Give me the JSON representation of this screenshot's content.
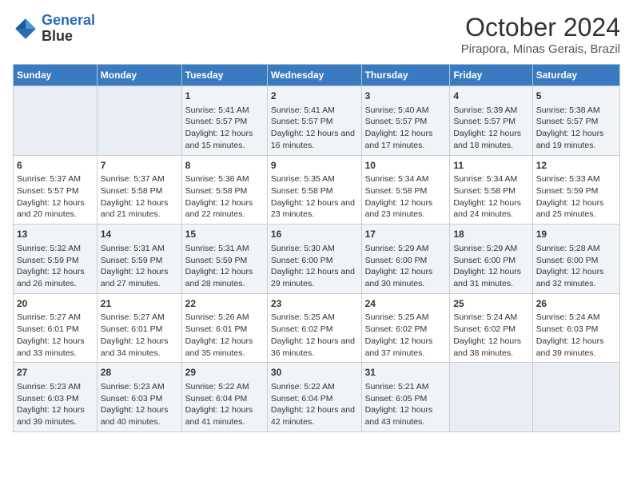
{
  "logo": {
    "line1": "General",
    "line2": "Blue"
  },
  "title": "October 2024",
  "location": "Pirapora, Minas Gerais, Brazil",
  "days_of_week": [
    "Sunday",
    "Monday",
    "Tuesday",
    "Wednesday",
    "Thursday",
    "Friday",
    "Saturday"
  ],
  "weeks": [
    [
      {
        "day": "",
        "sunrise": "",
        "sunset": "",
        "daylight": ""
      },
      {
        "day": "",
        "sunrise": "",
        "sunset": "",
        "daylight": ""
      },
      {
        "day": "1",
        "sunrise": "Sunrise: 5:41 AM",
        "sunset": "Sunset: 5:57 PM",
        "daylight": "Daylight: 12 hours and 15 minutes."
      },
      {
        "day": "2",
        "sunrise": "Sunrise: 5:41 AM",
        "sunset": "Sunset: 5:57 PM",
        "daylight": "Daylight: 12 hours and 16 minutes."
      },
      {
        "day": "3",
        "sunrise": "Sunrise: 5:40 AM",
        "sunset": "Sunset: 5:57 PM",
        "daylight": "Daylight: 12 hours and 17 minutes."
      },
      {
        "day": "4",
        "sunrise": "Sunrise: 5:39 AM",
        "sunset": "Sunset: 5:57 PM",
        "daylight": "Daylight: 12 hours and 18 minutes."
      },
      {
        "day": "5",
        "sunrise": "Sunrise: 5:38 AM",
        "sunset": "Sunset: 5:57 PM",
        "daylight": "Daylight: 12 hours and 19 minutes."
      }
    ],
    [
      {
        "day": "6",
        "sunrise": "Sunrise: 5:37 AM",
        "sunset": "Sunset: 5:57 PM",
        "daylight": "Daylight: 12 hours and 20 minutes."
      },
      {
        "day": "7",
        "sunrise": "Sunrise: 5:37 AM",
        "sunset": "Sunset: 5:58 PM",
        "daylight": "Daylight: 12 hours and 21 minutes."
      },
      {
        "day": "8",
        "sunrise": "Sunrise: 5:36 AM",
        "sunset": "Sunset: 5:58 PM",
        "daylight": "Daylight: 12 hours and 22 minutes."
      },
      {
        "day": "9",
        "sunrise": "Sunrise: 5:35 AM",
        "sunset": "Sunset: 5:58 PM",
        "daylight": "Daylight: 12 hours and 23 minutes."
      },
      {
        "day": "10",
        "sunrise": "Sunrise: 5:34 AM",
        "sunset": "Sunset: 5:58 PM",
        "daylight": "Daylight: 12 hours and 23 minutes."
      },
      {
        "day": "11",
        "sunrise": "Sunrise: 5:34 AM",
        "sunset": "Sunset: 5:58 PM",
        "daylight": "Daylight: 12 hours and 24 minutes."
      },
      {
        "day": "12",
        "sunrise": "Sunrise: 5:33 AM",
        "sunset": "Sunset: 5:59 PM",
        "daylight": "Daylight: 12 hours and 25 minutes."
      }
    ],
    [
      {
        "day": "13",
        "sunrise": "Sunrise: 5:32 AM",
        "sunset": "Sunset: 5:59 PM",
        "daylight": "Daylight: 12 hours and 26 minutes."
      },
      {
        "day": "14",
        "sunrise": "Sunrise: 5:31 AM",
        "sunset": "Sunset: 5:59 PM",
        "daylight": "Daylight: 12 hours and 27 minutes."
      },
      {
        "day": "15",
        "sunrise": "Sunrise: 5:31 AM",
        "sunset": "Sunset: 5:59 PM",
        "daylight": "Daylight: 12 hours and 28 minutes."
      },
      {
        "day": "16",
        "sunrise": "Sunrise: 5:30 AM",
        "sunset": "Sunset: 6:00 PM",
        "daylight": "Daylight: 12 hours and 29 minutes."
      },
      {
        "day": "17",
        "sunrise": "Sunrise: 5:29 AM",
        "sunset": "Sunset: 6:00 PM",
        "daylight": "Daylight: 12 hours and 30 minutes."
      },
      {
        "day": "18",
        "sunrise": "Sunrise: 5:29 AM",
        "sunset": "Sunset: 6:00 PM",
        "daylight": "Daylight: 12 hours and 31 minutes."
      },
      {
        "day": "19",
        "sunrise": "Sunrise: 5:28 AM",
        "sunset": "Sunset: 6:00 PM",
        "daylight": "Daylight: 12 hours and 32 minutes."
      }
    ],
    [
      {
        "day": "20",
        "sunrise": "Sunrise: 5:27 AM",
        "sunset": "Sunset: 6:01 PM",
        "daylight": "Daylight: 12 hours and 33 minutes."
      },
      {
        "day": "21",
        "sunrise": "Sunrise: 5:27 AM",
        "sunset": "Sunset: 6:01 PM",
        "daylight": "Daylight: 12 hours and 34 minutes."
      },
      {
        "day": "22",
        "sunrise": "Sunrise: 5:26 AM",
        "sunset": "Sunset: 6:01 PM",
        "daylight": "Daylight: 12 hours and 35 minutes."
      },
      {
        "day": "23",
        "sunrise": "Sunrise: 5:25 AM",
        "sunset": "Sunset: 6:02 PM",
        "daylight": "Daylight: 12 hours and 36 minutes."
      },
      {
        "day": "24",
        "sunrise": "Sunrise: 5:25 AM",
        "sunset": "Sunset: 6:02 PM",
        "daylight": "Daylight: 12 hours and 37 minutes."
      },
      {
        "day": "25",
        "sunrise": "Sunrise: 5:24 AM",
        "sunset": "Sunset: 6:02 PM",
        "daylight": "Daylight: 12 hours and 38 minutes."
      },
      {
        "day": "26",
        "sunrise": "Sunrise: 5:24 AM",
        "sunset": "Sunset: 6:03 PM",
        "daylight": "Daylight: 12 hours and 39 minutes."
      }
    ],
    [
      {
        "day": "27",
        "sunrise": "Sunrise: 5:23 AM",
        "sunset": "Sunset: 6:03 PM",
        "daylight": "Daylight: 12 hours and 39 minutes."
      },
      {
        "day": "28",
        "sunrise": "Sunrise: 5:23 AM",
        "sunset": "Sunset: 6:03 PM",
        "daylight": "Daylight: 12 hours and 40 minutes."
      },
      {
        "day": "29",
        "sunrise": "Sunrise: 5:22 AM",
        "sunset": "Sunset: 6:04 PM",
        "daylight": "Daylight: 12 hours and 41 minutes."
      },
      {
        "day": "30",
        "sunrise": "Sunrise: 5:22 AM",
        "sunset": "Sunset: 6:04 PM",
        "daylight": "Daylight: 12 hours and 42 minutes."
      },
      {
        "day": "31",
        "sunrise": "Sunrise: 5:21 AM",
        "sunset": "Sunset: 6:05 PM",
        "daylight": "Daylight: 12 hours and 43 minutes."
      },
      {
        "day": "",
        "sunrise": "",
        "sunset": "",
        "daylight": ""
      },
      {
        "day": "",
        "sunrise": "",
        "sunset": "",
        "daylight": ""
      }
    ]
  ]
}
